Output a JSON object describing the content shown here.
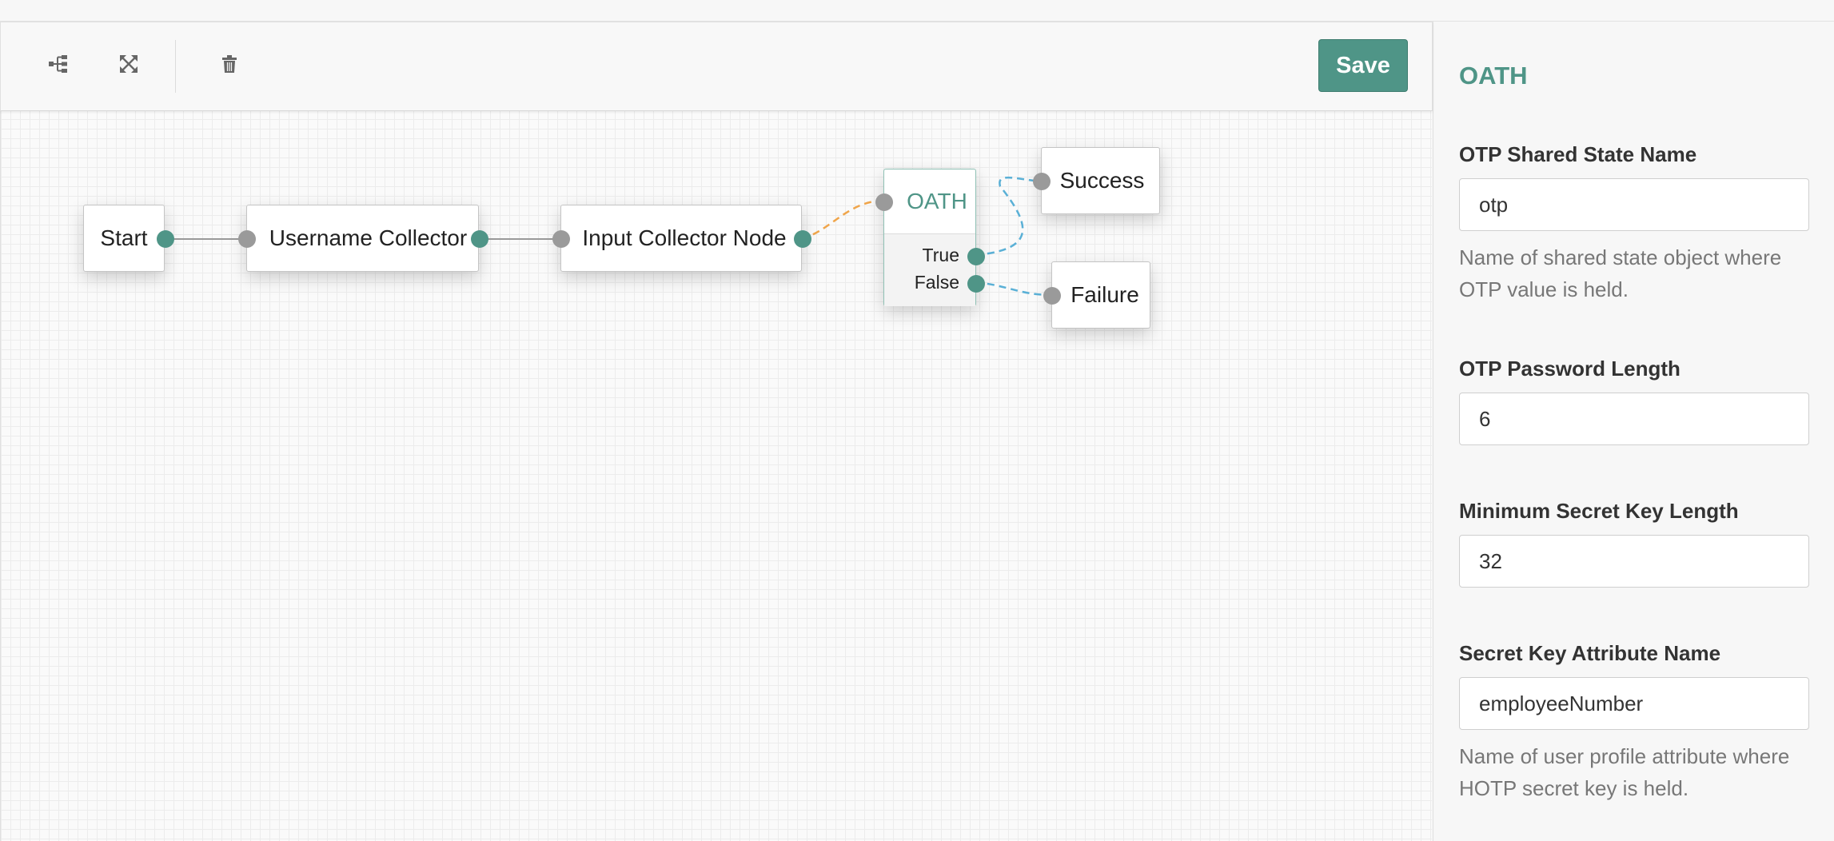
{
  "toolbar": {
    "tidy_icon": "tree-layout-icon",
    "fullscreen_icon": "expand-icon",
    "delete_icon": "trash-icon",
    "save_label": "Save",
    "accent_color": "#4f9587"
  },
  "canvas": {
    "nodes": {
      "start": "Start",
      "username_collector": "Username Collector",
      "input_collector": "Input Collector Node",
      "oath": "OATH",
      "success": "Success",
      "failure": "Failure"
    },
    "outcomes": {
      "true": "True",
      "false": "False"
    }
  },
  "panel": {
    "title": "OATH",
    "fields": [
      {
        "label": "OTP Shared State Name",
        "value": "otp",
        "help": "Name of shared state object where OTP value is held."
      },
      {
        "label": "OTP Password Length",
        "value": "6"
      },
      {
        "label": "Minimum Secret Key Length",
        "value": "32"
      },
      {
        "label": "Secret Key Attribute Name",
        "value": "employeeNumber",
        "help": "Name of user profile attribute where HOTP secret key is held."
      }
    ]
  }
}
